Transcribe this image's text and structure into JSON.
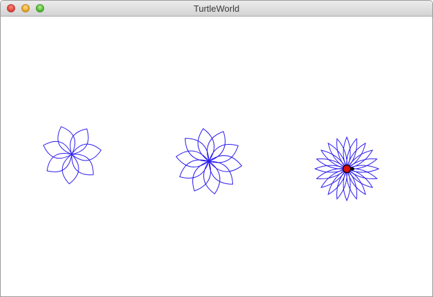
{
  "window": {
    "title": "TurtleWorld"
  },
  "colors": {
    "pen": "#2a1aee",
    "turtle_body": "#e01010",
    "turtle_outline": "#000000"
  },
  "drawing": {
    "flowers": [
      {
        "petals": 7
      },
      {
        "petals": 10
      },
      {
        "petals": 20
      }
    ]
  }
}
